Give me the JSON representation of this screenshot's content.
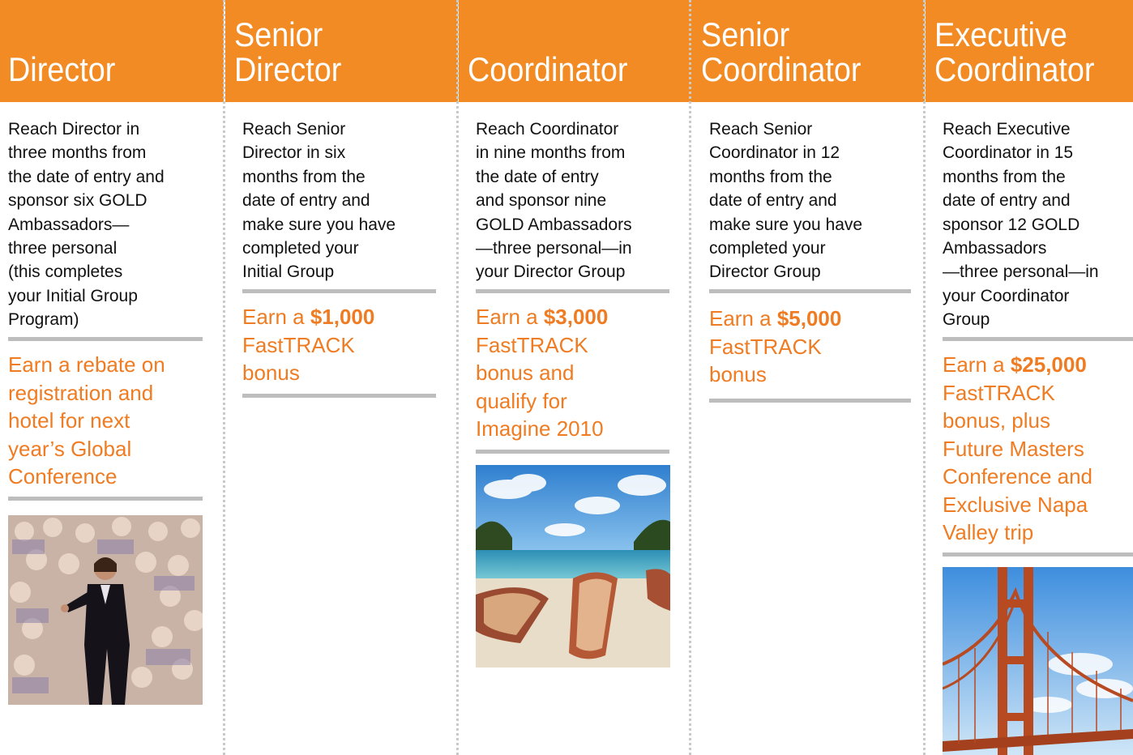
{
  "columns": [
    {
      "title": "Director",
      "description": "Reach Director in\nthree months from\nthe date of entry and\nsponsor six GOLD\nAmbassadors—\nthree personal\n(this completes\nyour Initial Group\nProgram)",
      "reward_pre": "Earn a rebate on\nregistration and\nhotel for next\nyear’s Global\nConference",
      "reward_amount": "",
      "reward_post": "",
      "image_alt": "Speaker on stage in front of a large audience"
    },
    {
      "title": "Senior\nDirector",
      "description": "Reach Senior\nDirector in six\nmonths from the\ndate of entry and\nmake sure you have\ncompleted your\nInitial Group",
      "reward_pre": "Earn a ",
      "reward_amount": "$1,000",
      "reward_post": "\nFastTRACK\nbonus",
      "image_alt": ""
    },
    {
      "title": "Coordinator",
      "description": "Reach Coordinator\nin nine months from\nthe date of entry\nand sponsor nine\nGOLD Ambassadors\n—three personal—in\nyour Director Group",
      "reward_pre": "Earn a ",
      "reward_amount": "$3,000",
      "reward_post": "\nFastTRACK\nbonus and\nqualify for\nImagine 2010",
      "image_alt": "Rowboats on a tropical beach"
    },
    {
      "title": "Senior\nCoordinator",
      "description": "Reach Senior\nCoordinator in 12\nmonths from the\ndate of entry and\nmake sure you have\ncompleted your\nDirector Group",
      "reward_pre": "Earn a ",
      "reward_amount": "$5,000",
      "reward_post": "\nFastTRACK\nbonus",
      "image_alt": ""
    },
    {
      "title": "Executive\nCoordinator",
      "description": "Reach Executive\nCoordinator in 15\nmonths from the\ndate of entry and\nsponsor 12 GOLD\nAmbassadors\n—three personal—in\nyour Coordinator\nGroup",
      "reward_pre": "Earn a ",
      "reward_amount": "$25,000",
      "reward_post": "\nFastTRACK\nbonus, plus\nFuture Masters\nConference and\nExclusive Napa\nValley trip",
      "image_alt": "Golden Gate Bridge"
    }
  ],
  "colors": {
    "header": "#f28b24",
    "header_text": "#ffffff",
    "reward_text": "#ef7c22",
    "rule": "#bdbdbd"
  }
}
